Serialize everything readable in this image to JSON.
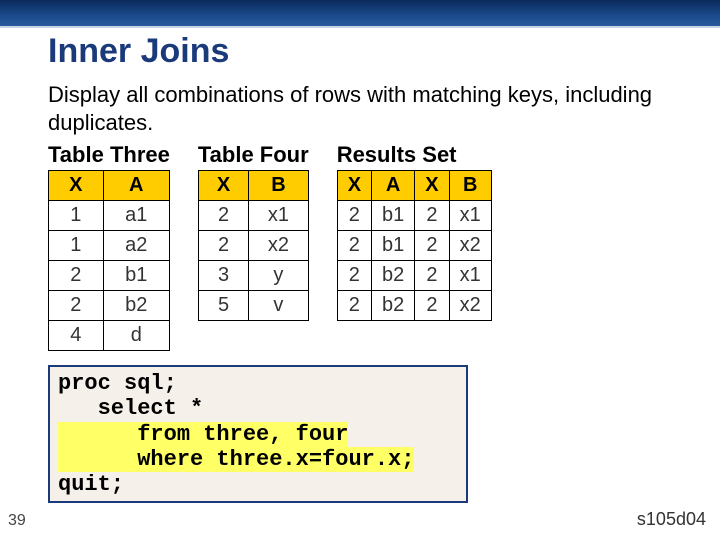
{
  "title": "Inner Joins",
  "description": "Display all combinations of rows with matching keys, including duplicates.",
  "table_three": {
    "label": "Table Three",
    "headers": [
      "X",
      "A"
    ],
    "rows": [
      [
        "1",
        "a1"
      ],
      [
        "1",
        "a2"
      ],
      [
        "2",
        "b1"
      ],
      [
        "2",
        "b2"
      ],
      [
        "4",
        "d"
      ]
    ]
  },
  "table_four": {
    "label": "Table Four",
    "headers": [
      "X",
      "B"
    ],
    "rows": [
      [
        "2",
        "x1"
      ],
      [
        "2",
        "x2"
      ],
      [
        "3",
        "y"
      ],
      [
        "5",
        "v"
      ]
    ]
  },
  "results": {
    "label": "Results Set",
    "headers": [
      "X",
      "A",
      "X",
      "B"
    ],
    "rows": [
      [
        "2",
        "b1",
        "2",
        "x1"
      ],
      [
        "2",
        "b1",
        "2",
        "x2"
      ],
      [
        "2",
        "b2",
        "2",
        "x1"
      ],
      [
        "2",
        "b2",
        "2",
        "x2"
      ]
    ]
  },
  "code": {
    "line1": "proc sql;",
    "line2": "   select *",
    "line3": "      from three, four",
    "line4": "      where three.x=four.x;",
    "line5": "quit;"
  },
  "slide_number": "39",
  "slide_code": "s105d04"
}
